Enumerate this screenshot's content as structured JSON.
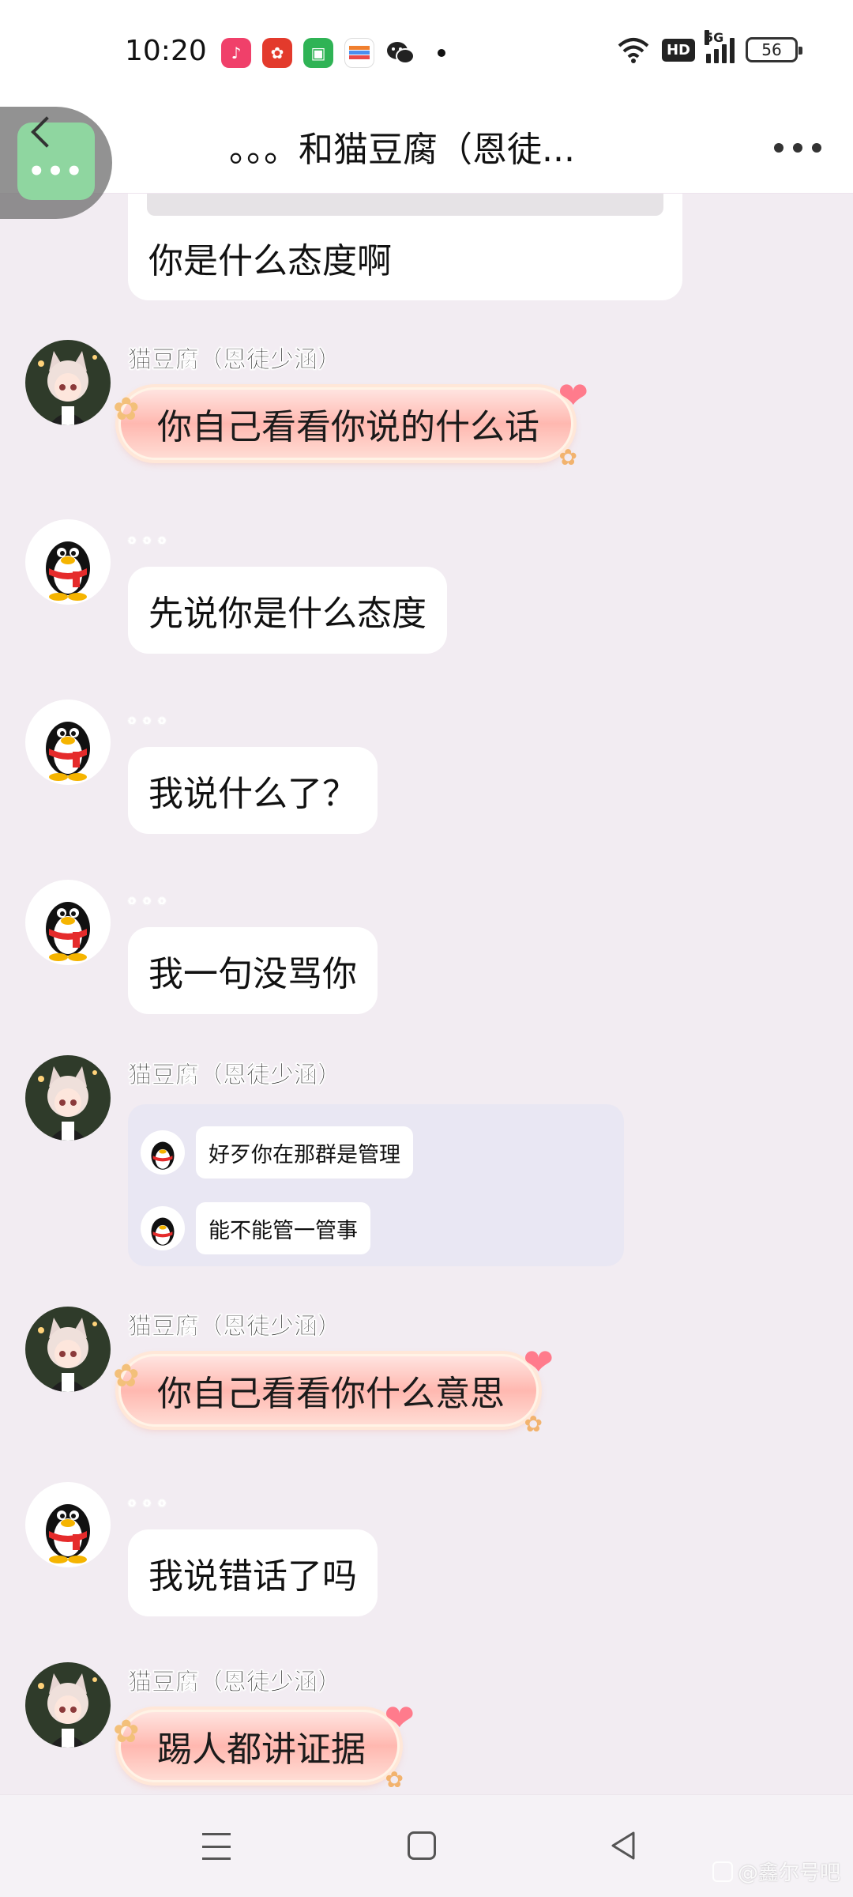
{
  "status_bar": {
    "time": "10:20",
    "network": "5G",
    "hd": "HD",
    "battery": "56"
  },
  "header": {
    "title": "。。。和猫豆腐（恩徒...",
    "more_icon": "more-dots-icon",
    "back_icon": "chevron-left-icon"
  },
  "messages": [
    {
      "sender": "",
      "text": "你是什么态度啊",
      "type": "bubble-partial"
    },
    {
      "sender": "猫豆腐（恩徒少涵）",
      "text": "你自己看看你说的什么话",
      "type": "fancy"
    },
    {
      "sender": "。。。",
      "text": "先说你是什么态度",
      "type": "bubble"
    },
    {
      "sender": "。。。",
      "text": "我说什么了？",
      "type": "bubble"
    },
    {
      "sender": "。。。",
      "text": "我一句没骂你",
      "type": "bubble"
    },
    {
      "sender": "猫豆腐（恩徒少涵）",
      "type": "forward",
      "items": [
        "好歹你在那群是管理",
        "能不能管一管事"
      ]
    },
    {
      "sender": "猫豆腐（恩徒少涵）",
      "text": "你自己看看你什么意思",
      "type": "fancy"
    },
    {
      "sender": "。。。",
      "text": "我说错话了吗",
      "type": "bubble"
    },
    {
      "sender": "猫豆腐（恩徒少涵）",
      "text": "踢人都讲证据",
      "type": "fancy"
    }
  ],
  "watermark": "@鑫尔号吧",
  "colors": {
    "background": "#f2ecf2",
    "bubble": "#ffffff",
    "fancy_bubble": "#ffb8b0",
    "back_button": "#8fd6a0"
  }
}
